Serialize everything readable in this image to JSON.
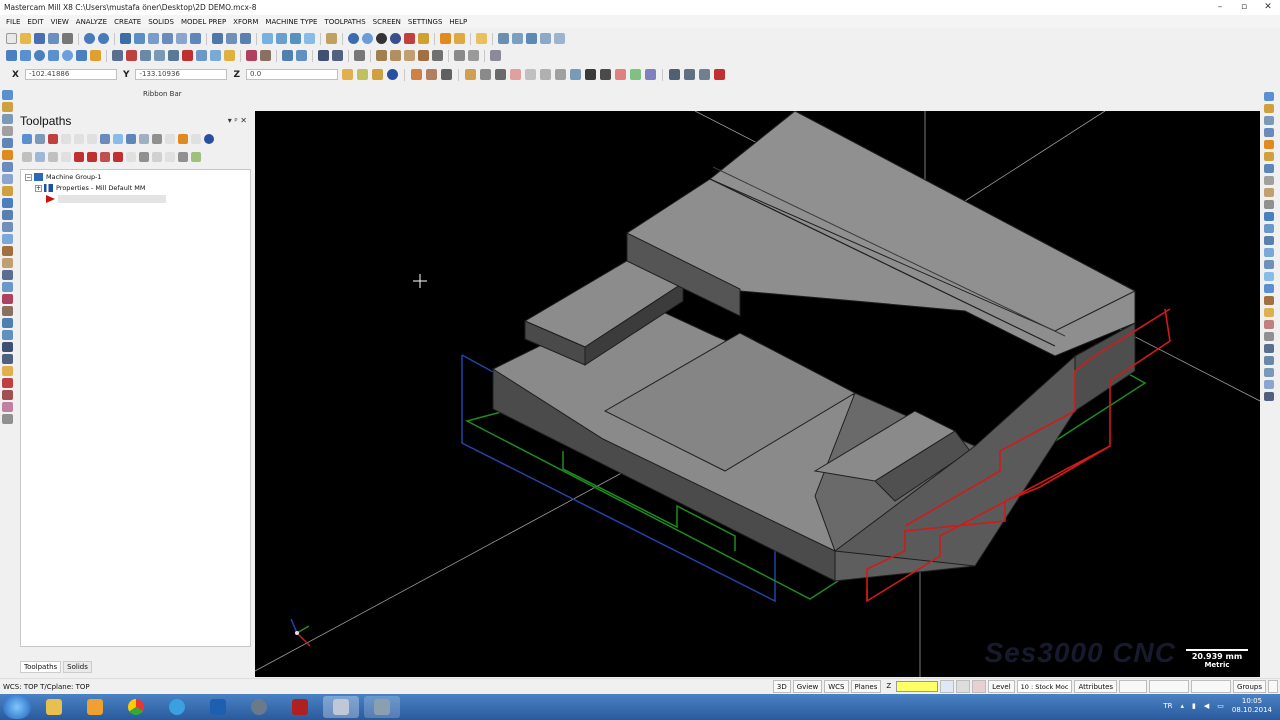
{
  "window": {
    "title": "Mastercam Mill X8  C:\\Users\\mustafa öner\\Desktop\\2D DEMO.mcx-8",
    "min": "–",
    "max": "▫",
    "close": "✕"
  },
  "menu": [
    "FILE",
    "EDIT",
    "VIEW",
    "ANALYZE",
    "CREATE",
    "SOLIDS",
    "MODEL PREP",
    "XFORM",
    "MACHINE TYPE",
    "TOOLPATHS",
    "SCREEN",
    "SETTINGS",
    "HELP"
  ],
  "coords": {
    "x_label": "X",
    "x_value": "-102.41886",
    "y_label": "Y",
    "y_value": "-133.10936",
    "z_label": "Z",
    "z_value": "0.0"
  },
  "ribbon": "Ribbon Bar",
  "panel": {
    "title": "Toolpaths",
    "pin": "▾  ᵖ  ✕",
    "tree": {
      "root": "Machine Group-1",
      "props": "Properties - Mill Default MM"
    },
    "tabs": [
      "Toolpaths",
      "Solids"
    ]
  },
  "viewport": {
    "scale_value": "20.939 mm",
    "scale_unit": "Metric",
    "watermark": "Ses3000 CNC",
    "colors": {
      "top": "#8a8a8a",
      "left": "#4f4f4f",
      "right": "#656565",
      "edge": "#1e1e1e",
      "red": "#d11a1a",
      "green": "#1e8a22",
      "blue": "#2244a8"
    }
  },
  "status": {
    "text": "WCS: TOP  T/Cplane: TOP",
    "buttons": [
      "3D",
      "Gview",
      "WCS",
      "Planes"
    ],
    "z_label": "Z",
    "level_label": "Level",
    "level_value": "10 : Stock Moc",
    "attributes": "Attributes",
    "groups": "Groups"
  },
  "taskbar": {
    "lang": "TR",
    "time": "10:05",
    "date": "08.10.2014"
  }
}
